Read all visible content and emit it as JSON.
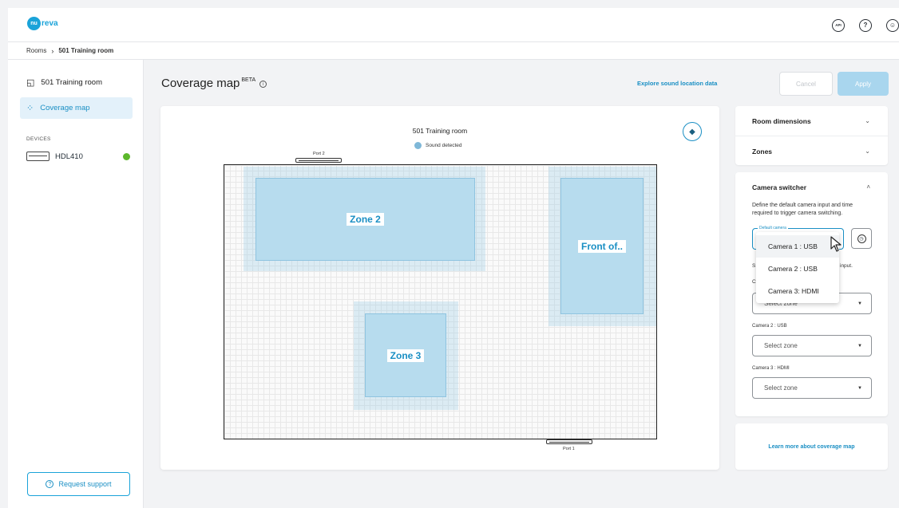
{
  "app": {
    "logo_badge": "nu",
    "logo_text": "reva",
    "brand_color": "#1aa3d9"
  },
  "header_icons": [
    {
      "name": "api-icon",
      "glyph": "API"
    },
    {
      "name": "help-icon",
      "glyph": "?"
    },
    {
      "name": "account-icon",
      "glyph": "☺"
    }
  ],
  "breadcrumb": {
    "root": "Rooms",
    "separator": "›",
    "current": "501 Training room"
  },
  "sidebar": {
    "items": [
      {
        "label": "501 Training room",
        "icon": "room-icon",
        "active": false
      },
      {
        "label": "Coverage map",
        "icon": "grid-icon",
        "active": true
      }
    ],
    "devices_heading": "DEVICES",
    "device": {
      "label": "HDL410",
      "status_color": "#5cb82c"
    },
    "support_button": "Request support"
  },
  "page": {
    "title": "Coverage map",
    "title_badge": "BETA",
    "explore_link": "Explore sound location data",
    "cancel_label": "Cancel",
    "apply_label": "Apply"
  },
  "map": {
    "room_title": "501 Training room",
    "legend_label": "Sound detected",
    "port_top": "Port 2",
    "port_bottom": "Port 1",
    "zones": [
      {
        "label": "Zone 2"
      },
      {
        "label": "Front of.."
      },
      {
        "label": "Zone 3"
      }
    ]
  },
  "panels": {
    "room_dimensions": "Room dimensions",
    "zones": "Zones",
    "camera_switcher": {
      "title": "Camera switcher",
      "description": "Define the default camera input and time required to trigger camera switching.",
      "default_camera_label": "Default camera",
      "partial_text_left": "S",
      "partial_text_right": "input.",
      "partial_label": "C",
      "select_placeholder": "Select zone",
      "camera2_label": "Camera 2 : USB",
      "camera3_label": "Camera 3 : HDMI"
    },
    "learn_link": "Learn more about coverage map"
  },
  "dropdown": {
    "options": [
      "Camera 1 : USB",
      "Camera 2 : USB",
      "Camera 3: HDMI"
    ]
  }
}
